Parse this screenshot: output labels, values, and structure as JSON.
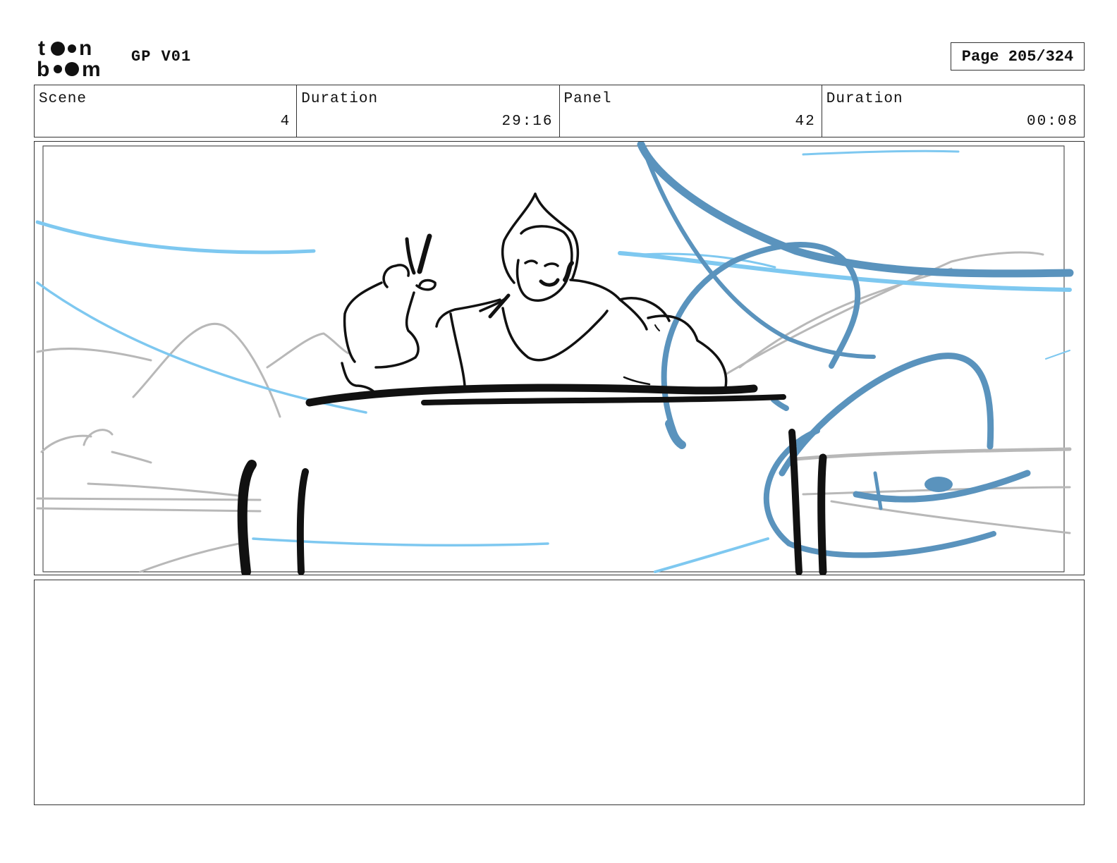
{
  "header": {
    "logo_text": "toon boom",
    "title": "GP V01",
    "page_indicator": "Page 205/324"
  },
  "info_bar": {
    "scene": {
      "label": "Scene",
      "value": "4"
    },
    "scene_duration": {
      "label": "Duration",
      "value": "29:16"
    },
    "panel": {
      "label": "Panel",
      "value": "42"
    },
    "panel_duration": {
      "label": "Duration",
      "value": "00:08"
    }
  },
  "colors": {
    "ink": "#111111",
    "light_blue": "#7ec8f0",
    "steel_blue": "#5a93bd",
    "gray": "#b8b8b8"
  }
}
